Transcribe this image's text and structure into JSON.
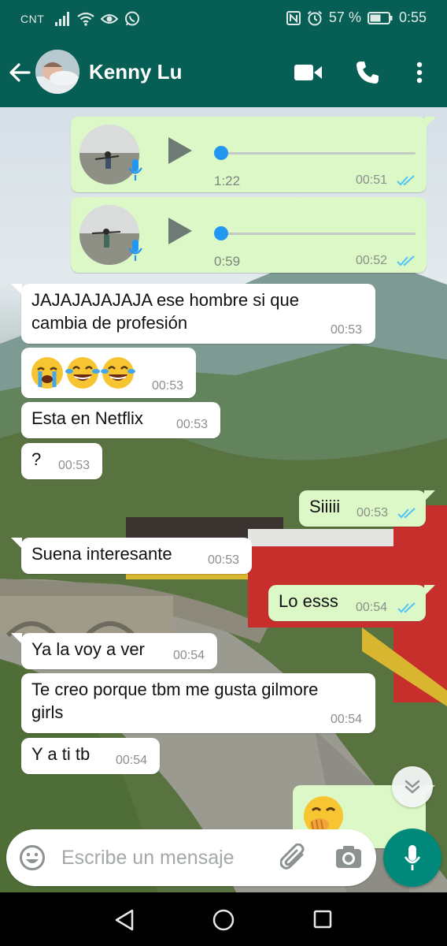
{
  "status_bar": {
    "carrier": "CNT",
    "battery": "57 %",
    "time": "0:55",
    "icons": [
      "signal-icon",
      "wifi-icon",
      "eye-icon",
      "whatsapp-icon",
      "nfc-icon",
      "alarm-icon",
      "battery-icon"
    ]
  },
  "header": {
    "contact_name": "Kenny Lu",
    "icons": [
      "back-arrow-icon",
      "video-call-icon",
      "phone-call-icon",
      "more-options-icon"
    ]
  },
  "messages": [
    {
      "type": "voice",
      "dir": "out",
      "duration": "1:22",
      "time": "00:51",
      "progress": 0.0,
      "read": true
    },
    {
      "type": "voice",
      "dir": "out",
      "duration": "0:59",
      "time": "00:52",
      "progress": 0.0,
      "read": true
    },
    {
      "type": "text",
      "dir": "in",
      "lines": [
        "JAJAJAJAJAJA ese hombre si que",
        "cambia de profesión"
      ],
      "time": "00:53"
    },
    {
      "type": "emoji",
      "dir": "in",
      "emojis": [
        "loudly-crying-face",
        "face-with-tears-of-joy",
        "face-with-tears-of-joy"
      ],
      "time": "00:53"
    },
    {
      "type": "text",
      "dir": "in",
      "text": "Esta en Netflix",
      "time": "00:53"
    },
    {
      "type": "text",
      "dir": "in",
      "text": "?",
      "time": "00:53"
    },
    {
      "type": "text",
      "dir": "out",
      "text": "Siiiii",
      "time": "00:53",
      "read": true
    },
    {
      "type": "text",
      "dir": "in",
      "text": "Suena interesante",
      "time": "00:53"
    },
    {
      "type": "text",
      "dir": "out",
      "text": "Lo esss",
      "time": "00:54",
      "read": true
    },
    {
      "type": "text",
      "dir": "in",
      "text": "Ya la voy a ver",
      "time": "00:54"
    },
    {
      "type": "text",
      "dir": "in",
      "lines": [
        "Te creo porque tbm me gusta gilmore",
        "girls"
      ],
      "time": "00:54"
    },
    {
      "type": "text",
      "dir": "in",
      "text": "Y a ti tb",
      "time": "00:54"
    },
    {
      "type": "emoji",
      "dir": "out",
      "emojis": [
        "face-with-hand-over-mouth"
      ],
      "partial": true
    }
  ],
  "input": {
    "placeholder": "Escribe un mensaje",
    "icons": [
      "emoji-icon",
      "attach-icon",
      "camera-icon",
      "mic-icon"
    ]
  },
  "nav": {
    "icons": [
      "back-triangle-icon",
      "home-circle-icon",
      "recents-square-icon"
    ]
  },
  "colors": {
    "header": "#075e54",
    "outgoing_bubble": "#dcf8c6",
    "incoming_bubble": "#ffffff",
    "read_tick": "#4fc3f7",
    "mic_button": "#00897b",
    "voice_progress": "#2196f3"
  }
}
